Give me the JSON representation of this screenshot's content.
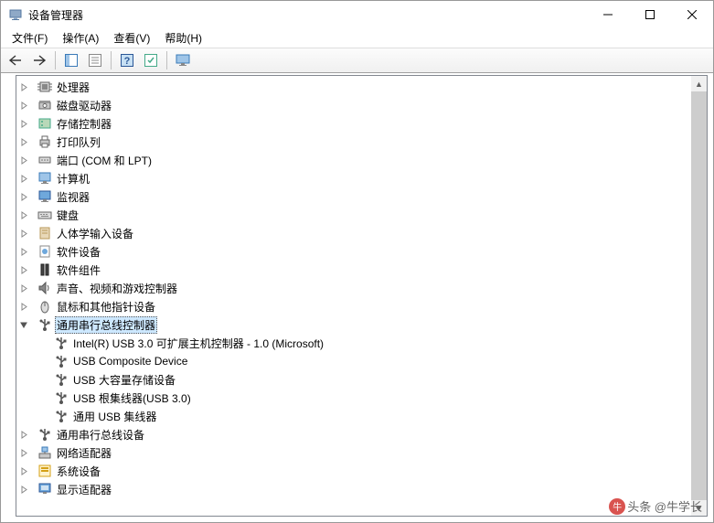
{
  "window": {
    "title": "设备管理器"
  },
  "menu": {
    "file": "文件(F)",
    "action": "操作(A)",
    "view": "查看(V)",
    "help": "帮助(H)"
  },
  "tree": {
    "items": [
      {
        "label": "处理器",
        "icon": "cpu"
      },
      {
        "label": "磁盘驱动器",
        "icon": "disk"
      },
      {
        "label": "存储控制器",
        "icon": "storage"
      },
      {
        "label": "打印队列",
        "icon": "printer"
      },
      {
        "label": "端口 (COM 和 LPT)",
        "icon": "port"
      },
      {
        "label": "计算机",
        "icon": "computer"
      },
      {
        "label": "监视器",
        "icon": "monitor"
      },
      {
        "label": "键盘",
        "icon": "keyboard"
      },
      {
        "label": "人体学输入设备",
        "icon": "hid"
      },
      {
        "label": "软件设备",
        "icon": "software"
      },
      {
        "label": "软件组件",
        "icon": "component"
      },
      {
        "label": "声音、视频和游戏控制器",
        "icon": "audio"
      },
      {
        "label": "鼠标和其他指针设备",
        "icon": "mouse"
      }
    ],
    "usb_controller": {
      "label": "通用串行总线控制器",
      "children": [
        "Intel(R) USB 3.0 可扩展主机控制器 - 1.0 (Microsoft)",
        "USB Composite Device",
        "USB 大容量存储设备",
        "USB 根集线器(USB 3.0)",
        "通用 USB 集线器"
      ]
    },
    "after": [
      {
        "label": "通用串行总线设备",
        "icon": "usb"
      },
      {
        "label": "网络适配器",
        "icon": "network"
      },
      {
        "label": "系统设备",
        "icon": "system"
      },
      {
        "label": "显示适配器",
        "icon": "display"
      }
    ]
  },
  "watermark": "头条 @牛学长"
}
